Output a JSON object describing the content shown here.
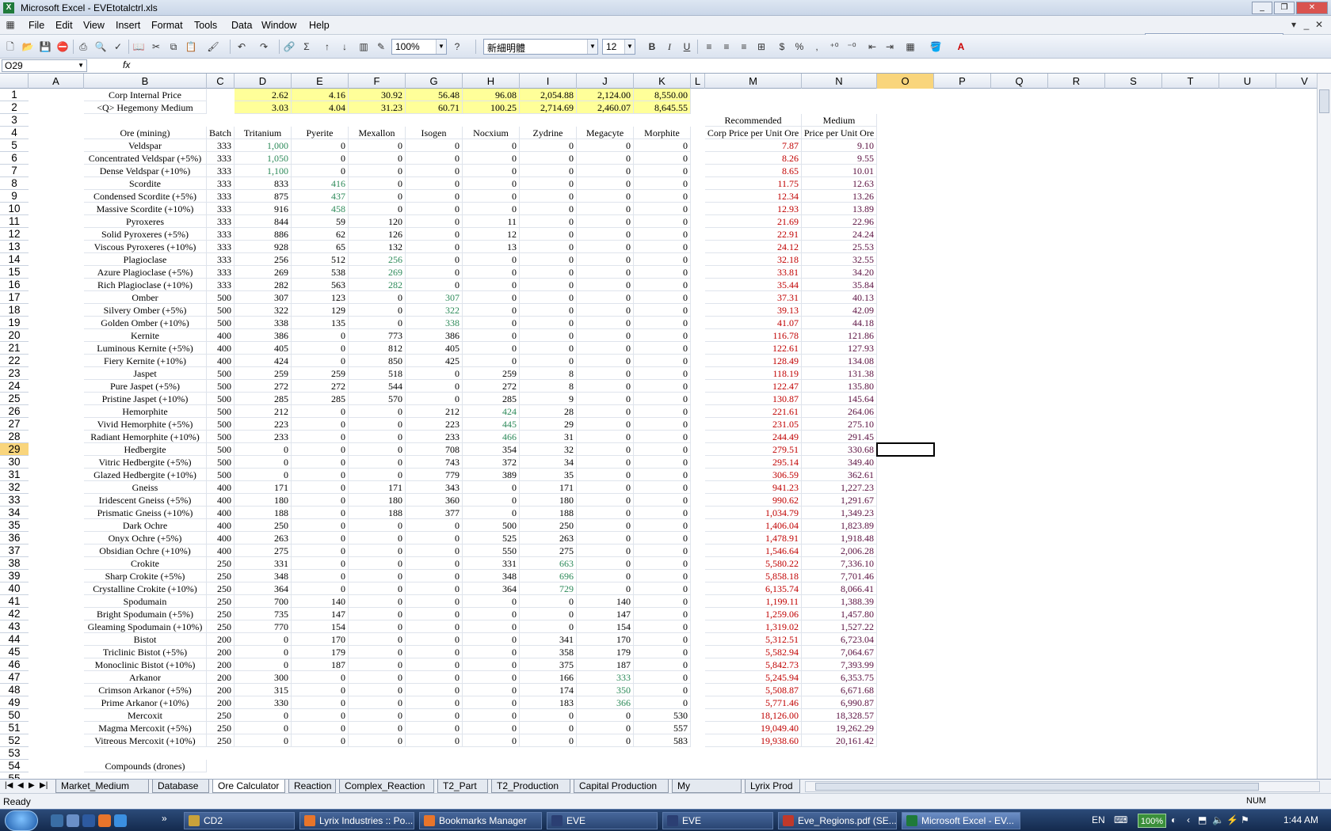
{
  "window": {
    "title": "Microsoft Excel - EVEtotalctrl.xls"
  },
  "menu": [
    "File",
    "Edit",
    "View",
    "Insert",
    "Format",
    "Tools",
    "Data",
    "Window",
    "Help"
  ],
  "help_placeholder": "Type a question for help",
  "toolbar": {
    "zoom": "100%",
    "font": "新細明體",
    "size": "12",
    "bold": "B",
    "italic": "I",
    "underline": "U",
    "currency": "$",
    "percent": "%",
    "comma": ","
  },
  "name_box": "O29",
  "fx_label": "fx",
  "columns": [
    "A",
    "B",
    "C",
    "D",
    "E",
    "F",
    "G",
    "H",
    "I",
    "J",
    "K",
    "L",
    "M",
    "N",
    "O",
    "P",
    "Q",
    "R",
    "S",
    "T",
    "U",
    "V"
  ],
  "selected_column": "O",
  "selected_row": "29",
  "header_rows": {
    "r1": {
      "label": "Corp Internal Price",
      "values": [
        "2.62",
        "4.16",
        "30.92",
        "56.48",
        "96.08",
        "2,054.88",
        "2,124.00",
        "8,550.00"
      ]
    },
    "r2": {
      "label": "<Q> Hegemony Medium",
      "values": [
        "3.03",
        "4.04",
        "31.23",
        "60.71",
        "100.25",
        "2,714.69",
        "2,460.07",
        "8,645.55"
      ]
    },
    "r3": {
      "M": "Recommended",
      "N": "Medium"
    },
    "r4": {
      "B": "Ore (mining)",
      "C": "Batch",
      "D": "Tritanium",
      "E": "Pyerite",
      "F": "Mexallon",
      "G": "Isogen",
      "H": "Nocxium",
      "I": "Zydrine",
      "J": "Megacyte",
      "K": "Morphite",
      "M": "Corp Price per Unit Ore",
      "N": "Price per Unit Ore"
    }
  },
  "ores": [
    {
      "row": "5",
      "name": "Veldspar",
      "batch": "333",
      "v": [
        "1,000",
        "0",
        "0",
        "0",
        "0",
        "0",
        "0",
        "0"
      ],
      "m": "7.87",
      "n": "9.10",
      "g": [
        0
      ]
    },
    {
      "row": "6",
      "name": "Concentrated Veldspar (+5%)",
      "batch": "333",
      "v": [
        "1,050",
        "0",
        "0",
        "0",
        "0",
        "0",
        "0",
        "0"
      ],
      "m": "8.26",
      "n": "9.55",
      "g": [
        0
      ]
    },
    {
      "row": "7",
      "name": "Dense Veldspar (+10%)",
      "batch": "333",
      "v": [
        "1,100",
        "0",
        "0",
        "0",
        "0",
        "0",
        "0",
        "0"
      ],
      "m": "8.65",
      "n": "10.01",
      "g": [
        0
      ]
    },
    {
      "row": "8",
      "name": "Scordite",
      "batch": "333",
      "v": [
        "833",
        "416",
        "0",
        "0",
        "0",
        "0",
        "0",
        "0"
      ],
      "m": "11.75",
      "n": "12.63",
      "g": [
        1
      ]
    },
    {
      "row": "9",
      "name": "Condensed Scordite (+5%)",
      "batch": "333",
      "v": [
        "875",
        "437",
        "0",
        "0",
        "0",
        "0",
        "0",
        "0"
      ],
      "m": "12.34",
      "n": "13.26",
      "g": [
        1
      ]
    },
    {
      "row": "10",
      "name": "Massive Scordite (+10%)",
      "batch": "333",
      "v": [
        "916",
        "458",
        "0",
        "0",
        "0",
        "0",
        "0",
        "0"
      ],
      "m": "12.93",
      "n": "13.89",
      "g": [
        1
      ]
    },
    {
      "row": "11",
      "name": "Pyroxeres",
      "batch": "333",
      "v": [
        "844",
        "59",
        "120",
        "0",
        "11",
        "0",
        "0",
        "0"
      ],
      "m": "21.69",
      "n": "22.96",
      "g": []
    },
    {
      "row": "12",
      "name": "Solid Pyroxeres (+5%)",
      "batch": "333",
      "v": [
        "886",
        "62",
        "126",
        "0",
        "12",
        "0",
        "0",
        "0"
      ],
      "m": "22.91",
      "n": "24.24",
      "g": []
    },
    {
      "row": "13",
      "name": "Viscous Pyroxeres (+10%)",
      "batch": "333",
      "v": [
        "928",
        "65",
        "132",
        "0",
        "13",
        "0",
        "0",
        "0"
      ],
      "m": "24.12",
      "n": "25.53",
      "g": []
    },
    {
      "row": "14",
      "name": "Plagioclase",
      "batch": "333",
      "v": [
        "256",
        "512",
        "256",
        "0",
        "0",
        "0",
        "0",
        "0"
      ],
      "m": "32.18",
      "n": "32.55",
      "g": [
        2
      ]
    },
    {
      "row": "15",
      "name": "Azure Plagioclase (+5%)",
      "batch": "333",
      "v": [
        "269",
        "538",
        "269",
        "0",
        "0",
        "0",
        "0",
        "0"
      ],
      "m": "33.81",
      "n": "34.20",
      "g": [
        2
      ]
    },
    {
      "row": "16",
      "name": "Rich Plagioclase (+10%)",
      "batch": "333",
      "v": [
        "282",
        "563",
        "282",
        "0",
        "0",
        "0",
        "0",
        "0"
      ],
      "m": "35.44",
      "n": "35.84",
      "g": [
        2
      ]
    },
    {
      "row": "17",
      "name": "Omber",
      "batch": "500",
      "v": [
        "307",
        "123",
        "0",
        "307",
        "0",
        "0",
        "0",
        "0"
      ],
      "m": "37.31",
      "n": "40.13",
      "g": [
        3
      ]
    },
    {
      "row": "18",
      "name": "Silvery Omber (+5%)",
      "batch": "500",
      "v": [
        "322",
        "129",
        "0",
        "322",
        "0",
        "0",
        "0",
        "0"
      ],
      "m": "39.13",
      "n": "42.09",
      "g": [
        3
      ]
    },
    {
      "row": "19",
      "name": "Golden Omber (+10%)",
      "batch": "500",
      "v": [
        "338",
        "135",
        "0",
        "338",
        "0",
        "0",
        "0",
        "0"
      ],
      "m": "41.07",
      "n": "44.18",
      "g": [
        3
      ]
    },
    {
      "row": "20",
      "name": "Kernite",
      "batch": "400",
      "v": [
        "386",
        "0",
        "773",
        "386",
        "0",
        "0",
        "0",
        "0"
      ],
      "m": "116.78",
      "n": "121.86",
      "g": []
    },
    {
      "row": "21",
      "name": "Luminous Kernite (+5%)",
      "batch": "400",
      "v": [
        "405",
        "0",
        "812",
        "405",
        "0",
        "0",
        "0",
        "0"
      ],
      "m": "122.61",
      "n": "127.93",
      "g": []
    },
    {
      "row": "22",
      "name": "Fiery Kernite (+10%)",
      "batch": "400",
      "v": [
        "424",
        "0",
        "850",
        "425",
        "0",
        "0",
        "0",
        "0"
      ],
      "m": "128.49",
      "n": "134.08",
      "g": []
    },
    {
      "row": "23",
      "name": "Jaspet",
      "batch": "500",
      "v": [
        "259",
        "259",
        "518",
        "0",
        "259",
        "8",
        "0",
        "0"
      ],
      "m": "118.19",
      "n": "131.38",
      "g": []
    },
    {
      "row": "24",
      "name": "Pure Jaspet (+5%)",
      "batch": "500",
      "v": [
        "272",
        "272",
        "544",
        "0",
        "272",
        "8",
        "0",
        "0"
      ],
      "m": "122.47",
      "n": "135.80",
      "g": []
    },
    {
      "row": "25",
      "name": "Pristine Jaspet (+10%)",
      "batch": "500",
      "v": [
        "285",
        "285",
        "570",
        "0",
        "285",
        "9",
        "0",
        "0"
      ],
      "m": "130.87",
      "n": "145.64",
      "g": []
    },
    {
      "row": "26",
      "name": "Hemorphite",
      "batch": "500",
      "v": [
        "212",
        "0",
        "0",
        "212",
        "424",
        "28",
        "0",
        "0"
      ],
      "m": "221.61",
      "n": "264.06",
      "g": [
        4
      ]
    },
    {
      "row": "27",
      "name": "Vivid Hemorphite (+5%)",
      "batch": "500",
      "v": [
        "223",
        "0",
        "0",
        "223",
        "445",
        "29",
        "0",
        "0"
      ],
      "m": "231.05",
      "n": "275.10",
      "g": [
        4
      ]
    },
    {
      "row": "28",
      "name": "Radiant Hemorphite (+10%)",
      "batch": "500",
      "v": [
        "233",
        "0",
        "0",
        "233",
        "466",
        "31",
        "0",
        "0"
      ],
      "m": "244.49",
      "n": "291.45",
      "g": [
        4
      ]
    },
    {
      "row": "29",
      "name": "Hedbergite",
      "batch": "500",
      "v": [
        "0",
        "0",
        "0",
        "708",
        "354",
        "32",
        "0",
        "0"
      ],
      "m": "279.51",
      "n": "330.68",
      "g": []
    },
    {
      "row": "30",
      "name": "Vitric Hedbergite (+5%)",
      "batch": "500",
      "v": [
        "0",
        "0",
        "0",
        "743",
        "372",
        "34",
        "0",
        "0"
      ],
      "m": "295.14",
      "n": "349.40",
      "g": []
    },
    {
      "row": "31",
      "name": "Glazed Hedbergite (+10%)",
      "batch": "500",
      "v": [
        "0",
        "0",
        "0",
        "779",
        "389",
        "35",
        "0",
        "0"
      ],
      "m": "306.59",
      "n": "362.61",
      "g": []
    },
    {
      "row": "32",
      "name": "Gneiss",
      "batch": "400",
      "v": [
        "171",
        "0",
        "171",
        "343",
        "0",
        "171",
        "0",
        "0"
      ],
      "m": "941.23",
      "n": "1,227.23",
      "g": []
    },
    {
      "row": "33",
      "name": "Iridescent Gneiss (+5%)",
      "batch": "400",
      "v": [
        "180",
        "0",
        "180",
        "360",
        "0",
        "180",
        "0",
        "0"
      ],
      "m": "990.62",
      "n": "1,291.67",
      "g": []
    },
    {
      "row": "34",
      "name": "Prismatic Gneiss (+10%)",
      "batch": "400",
      "v": [
        "188",
        "0",
        "188",
        "377",
        "0",
        "188",
        "0",
        "0"
      ],
      "m": "1,034.79",
      "n": "1,349.23",
      "g": []
    },
    {
      "row": "35",
      "name": "Dark Ochre",
      "batch": "400",
      "v": [
        "250",
        "0",
        "0",
        "0",
        "500",
        "250",
        "0",
        "0"
      ],
      "m": "1,406.04",
      "n": "1,823.89",
      "g": []
    },
    {
      "row": "36",
      "name": "Onyx Ochre (+5%)",
      "batch": "400",
      "v": [
        "263",
        "0",
        "0",
        "0",
        "525",
        "263",
        "0",
        "0"
      ],
      "m": "1,478.91",
      "n": "1,918.48",
      "g": []
    },
    {
      "row": "37",
      "name": "Obsidian Ochre (+10%)",
      "batch": "400",
      "v": [
        "275",
        "0",
        "0",
        "0",
        "550",
        "275",
        "0",
        "0"
      ],
      "m": "1,546.64",
      "n": "2,006.28",
      "g": []
    },
    {
      "row": "38",
      "name": "Crokite",
      "batch": "250",
      "v": [
        "331",
        "0",
        "0",
        "0",
        "331",
        "663",
        "0",
        "0"
      ],
      "m": "5,580.22",
      "n": "7,336.10",
      "g": [
        5
      ]
    },
    {
      "row": "39",
      "name": "Sharp Crokite (+5%)",
      "batch": "250",
      "v": [
        "348",
        "0",
        "0",
        "0",
        "348",
        "696",
        "0",
        "0"
      ],
      "m": "5,858.18",
      "n": "7,701.46",
      "g": [
        5
      ]
    },
    {
      "row": "40",
      "name": "Crystalline Crokite (+10%)",
      "batch": "250",
      "v": [
        "364",
        "0",
        "0",
        "0",
        "364",
        "729",
        "0",
        "0"
      ],
      "m": "6,135.74",
      "n": "8,066.41",
      "g": [
        5
      ]
    },
    {
      "row": "41",
      "name": "Spodumain",
      "batch": "250",
      "v": [
        "700",
        "140",
        "0",
        "0",
        "0",
        "0",
        "140",
        "0"
      ],
      "m": "1,199.11",
      "n": "1,388.39",
      "g": []
    },
    {
      "row": "42",
      "name": "Bright Spodumain (+5%)",
      "batch": "250",
      "v": [
        "735",
        "147",
        "0",
        "0",
        "0",
        "0",
        "147",
        "0"
      ],
      "m": "1,259.06",
      "n": "1,457.80",
      "g": []
    },
    {
      "row": "43",
      "name": "Gleaming Spodumain (+10%)",
      "batch": "250",
      "v": [
        "770",
        "154",
        "0",
        "0",
        "0",
        "0",
        "154",
        "0"
      ],
      "m": "1,319.02",
      "n": "1,527.22",
      "g": []
    },
    {
      "row": "44",
      "name": "Bistot",
      "batch": "200",
      "v": [
        "0",
        "170",
        "0",
        "0",
        "0",
        "341",
        "170",
        "0"
      ],
      "m": "5,312.51",
      "n": "6,723.04",
      "g": []
    },
    {
      "row": "45",
      "name": "Triclinic Bistot (+5%)",
      "batch": "200",
      "v": [
        "0",
        "179",
        "0",
        "0",
        "0",
        "358",
        "179",
        "0"
      ],
      "m": "5,582.94",
      "n": "7,064.67",
      "g": []
    },
    {
      "row": "46",
      "name": "Monoclinic Bistot (+10%)",
      "batch": "200",
      "v": [
        "0",
        "187",
        "0",
        "0",
        "0",
        "375",
        "187",
        "0"
      ],
      "m": "5,842.73",
      "n": "7,393.99",
      "g": []
    },
    {
      "row": "47",
      "name": "Arkanor",
      "batch": "200",
      "v": [
        "300",
        "0",
        "0",
        "0",
        "0",
        "166",
        "333",
        "0"
      ],
      "m": "5,245.94",
      "n": "6,353.75",
      "g": [
        6
      ]
    },
    {
      "row": "48",
      "name": "Crimson Arkanor (+5%)",
      "batch": "200",
      "v": [
        "315",
        "0",
        "0",
        "0",
        "0",
        "174",
        "350",
        "0"
      ],
      "m": "5,508.87",
      "n": "6,671.68",
      "g": [
        6
      ]
    },
    {
      "row": "49",
      "name": "Prime Arkanor (+10%)",
      "batch": "200",
      "v": [
        "330",
        "0",
        "0",
        "0",
        "0",
        "183",
        "366",
        "0"
      ],
      "m": "5,771.46",
      "n": "6,990.87",
      "g": [
        6
      ]
    },
    {
      "row": "50",
      "name": "Mercoxit",
      "batch": "250",
      "v": [
        "0",
        "0",
        "0",
        "0",
        "0",
        "0",
        "0",
        "530"
      ],
      "m": "18,126.00",
      "n": "18,328.57",
      "g": []
    },
    {
      "row": "51",
      "name": "Magma Mercoxit (+5%)",
      "batch": "250",
      "v": [
        "0",
        "0",
        "0",
        "0",
        "0",
        "0",
        "0",
        "557"
      ],
      "m": "19,049.40",
      "n": "19,262.29",
      "g": []
    },
    {
      "row": "52",
      "name": "Vitreous Mercoxit (+10%)",
      "batch": "250",
      "v": [
        "0",
        "0",
        "0",
        "0",
        "0",
        "0",
        "0",
        "583"
      ],
      "m": "19,938.60",
      "n": "20,161.42",
      "g": []
    }
  ],
  "row54": {
    "row": "54",
    "B": "Compounds (drones)"
  },
  "tabs": [
    "Market_Medium",
    "Database",
    "Ore Calculator",
    "Reaction",
    "Complex_Reaction",
    "T2_Part",
    "T2_Production",
    "Capital Production",
    "My Production",
    "Lyrix Prod"
  ],
  "active_tab": "Ore Calculator",
  "status": {
    "left": "Ready",
    "num": "NUM"
  },
  "taskbar": {
    "items": [
      "CD2",
      "Lyrix Industries :: Po...",
      "Bookmarks Manager",
      "EVE",
      "EVE",
      "Eve_Regions.pdf (SE...",
      "Microsoft Excel - EV..."
    ],
    "lang": "EN",
    "zoom": "100%",
    "clock": "1:44 AM"
  },
  "colors": {
    "green": "#2d8a5a",
    "red": "#c00000",
    "purple": "#5a1040",
    "highlight": "#ffff99",
    "selection": "#f9d57c"
  }
}
